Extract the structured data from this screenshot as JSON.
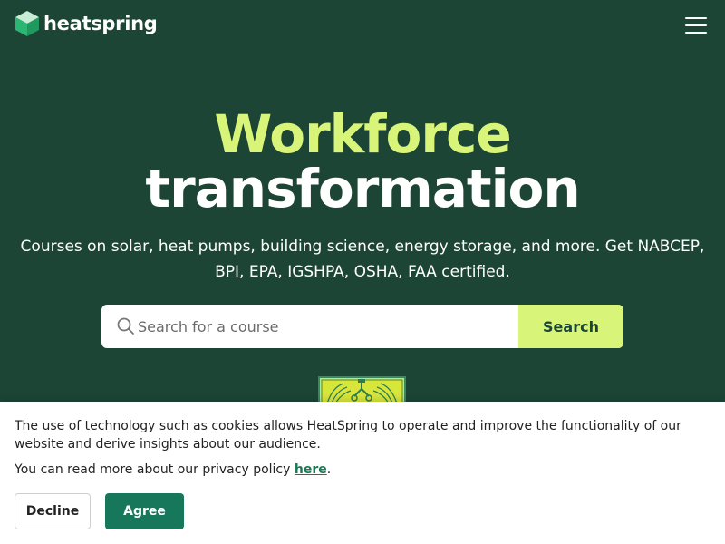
{
  "header": {
    "logo_text": "heatspring",
    "logo_icon": "cube-logo-icon",
    "menu_icon": "hamburger-menu-icon"
  },
  "hero": {
    "title_line1": "Workforce",
    "title_line2": "transformation",
    "subtitle": "Courses on solar, heat pumps, building science, energy storage, and more. Get NABCEP, BPI, EPA, IGSHPA, OSHA, FAA certified."
  },
  "search": {
    "placeholder": "Search for a course",
    "value": "",
    "button_label": "Search",
    "icon": "search-icon"
  },
  "cookie_banner": {
    "text": "The use of technology such as cookies allows HeatSpring to operate and improve the functionality of our website and derive insights about our audience.",
    "policy_prefix": "You can read more about our privacy policy ",
    "policy_link": "here",
    "policy_suffix": ".",
    "decline_label": "Decline",
    "agree_label": "Agree"
  },
  "colors": {
    "background": "#1c4535",
    "accent": "#d8f57a",
    "agree_button": "#17775a",
    "link": "#1a7a55"
  }
}
